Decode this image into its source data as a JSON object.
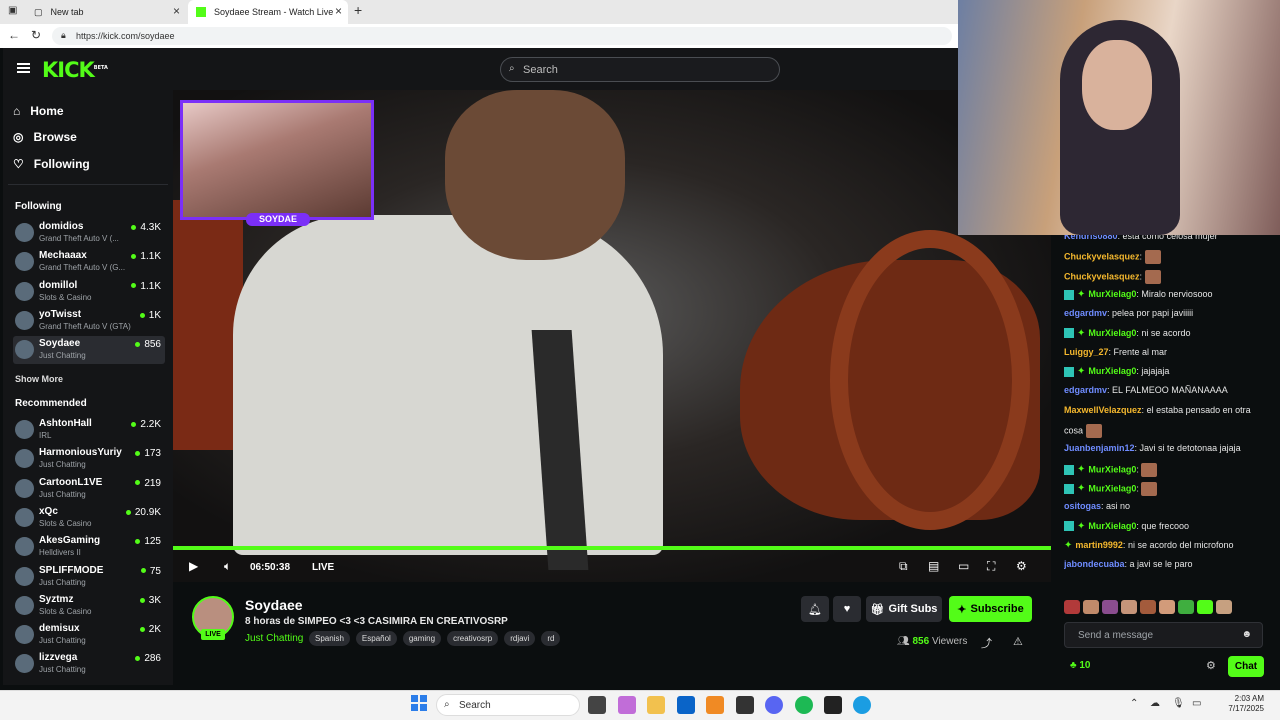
{
  "browser": {
    "tabs": [
      {
        "title": "New tab"
      },
      {
        "title": "Soydaee Stream - Watch Live on Kick"
      }
    ],
    "url": "https://kick.com/soydaee"
  },
  "header": {
    "logo": "KICK",
    "logo_sup": "BETA",
    "search_placeholder": "Search"
  },
  "nav": [
    {
      "label": "Home",
      "icon": "home-icon"
    },
    {
      "label": "Browse",
      "icon": "compass-icon"
    },
    {
      "label": "Following",
      "icon": "heart-icon"
    }
  ],
  "following": {
    "title": "Following",
    "channels": [
      {
        "name": "domidios",
        "category": "Grand Theft Auto V (...",
        "viewers": "4.3K"
      },
      {
        "name": "Mechaaax",
        "category": "Grand Theft Auto V (G...",
        "viewers": "1.1K"
      },
      {
        "name": "domillol",
        "category": "Slots & Casino",
        "viewers": "1.1K"
      },
      {
        "name": "yoTwisst",
        "category": "Grand Theft Auto V (GTA)",
        "viewers": "1K"
      },
      {
        "name": "Soydaee",
        "category": "Just Chatting",
        "viewers": "856"
      }
    ],
    "show_more": "Show More"
  },
  "recommended": {
    "title": "Recommended",
    "channels": [
      {
        "name": "AshtonHall",
        "category": "IRL",
        "viewers": "2.2K"
      },
      {
        "name": "HarmoniousYuriy",
        "category": "Just Chatting",
        "viewers": "173"
      },
      {
        "name": "CartoonL1VE",
        "category": "Just Chatting",
        "viewers": "219"
      },
      {
        "name": "xQc",
        "category": "Slots & Casino",
        "viewers": "20.9K"
      },
      {
        "name": "AkesGaming",
        "category": "Helldivers II",
        "viewers": "125"
      },
      {
        "name": "SPLIFFMODE",
        "category": "Just Chatting",
        "viewers": "75"
      },
      {
        "name": "Syztmz",
        "category": "Slots & Casino",
        "viewers": "3K"
      },
      {
        "name": "demisux",
        "category": "Just Chatting",
        "viewers": "2K"
      },
      {
        "name": "lizzvega",
        "category": "Just Chatting",
        "viewers": "286"
      }
    ]
  },
  "player": {
    "cam_label": "SOYDAE",
    "time": "06:50:38",
    "live": "LIVE"
  },
  "stream": {
    "name": "Soydaee",
    "title": "8 horas de SIMPEO  <3 <3 CASIMIRA EN CREATIVOSRP",
    "category": "Just Chatting",
    "live_badge": "LIVE",
    "tags": [
      "Spanish",
      "Español",
      "gaming",
      "creativosrp",
      "rdjavi",
      "rd"
    ],
    "gift_label": "Gift Subs",
    "subscribe_label": "Subscribe",
    "viewers": "856",
    "viewers_label": "Viewers"
  },
  "chat": {
    "messages": [
      {
        "user": "Kendris0880",
        "color": "#6f8cff",
        "text": "esta como celosa mujer"
      },
      {
        "user": "Chuckyvelasquez",
        "color": "#f5b82e",
        "text": "",
        "emote": true
      },
      {
        "user": "Chuckyvelasquez",
        "color": "#f5b82e",
        "text": "",
        "emote": true
      },
      {
        "user": "MurXielag0",
        "color": "#53fc18",
        "text": "Miralo nerviosooo",
        "badges": true
      },
      {
        "user": "edgardmv",
        "color": "#6f8cff",
        "text": "pelea por papi javiiiii"
      },
      {
        "user": "MurXielag0",
        "color": "#53fc18",
        "text": "ni se acordo",
        "badges": true
      },
      {
        "user": "Luiggy_27",
        "color": "#f5b82e",
        "text": "Frente al mar"
      },
      {
        "user": "MurXielag0",
        "color": "#53fc18",
        "text": "jajajaja",
        "badges": true
      },
      {
        "user": "edgardmv",
        "color": "#6f8cff",
        "text": "EL FALMEOO MAÑANAAAA"
      },
      {
        "user": "MaxwellVelazquez",
        "color": "#f5b82e",
        "text": "el estaba pensado en otra"
      },
      {
        "user": "",
        "color": "#e6e6e6",
        "text": "cosa",
        "emote": true
      },
      {
        "user": "Juanbenjamin12",
        "color": "#6f8cff",
        "text": "Javi si te detotonaa jajaja"
      },
      {
        "user": "MurXielag0",
        "color": "#53fc18",
        "text": "",
        "badges": true,
        "emote": true
      },
      {
        "user": "MurXielag0",
        "color": "#53fc18",
        "text": "",
        "badges": true,
        "emote": true
      },
      {
        "user": "ositogas",
        "color": "#6f8cff",
        "text": "asi no"
      },
      {
        "user": "MurXielag0",
        "color": "#53fc18",
        "text": "que frecooo",
        "badges": true
      },
      {
        "user": "martin9992",
        "color": "#f5b82e",
        "text": "ni se acordo del microfono",
        "diamond": true
      },
      {
        "user": "jabondecuaba",
        "color": "#6f8cff",
        "text": "a javi se le paro"
      }
    ],
    "input_placeholder": "Send a message",
    "points": "10",
    "chat_button": "Chat"
  },
  "taskbar": {
    "search_placeholder": "Search",
    "time": "2:03 AM",
    "date": "7/17/2025"
  },
  "colors": {
    "accent": "#53fc18",
    "bg": "#0b0e0f",
    "panel": "#141517"
  }
}
